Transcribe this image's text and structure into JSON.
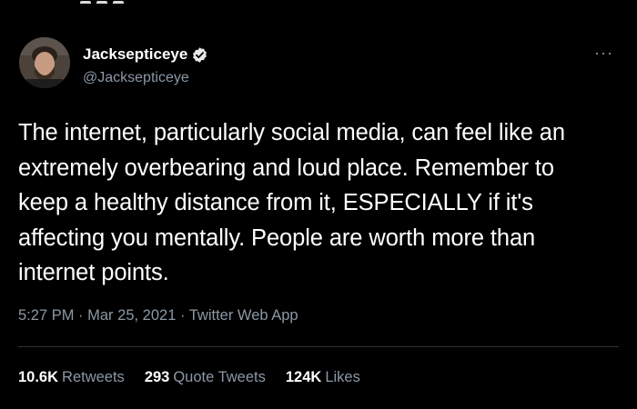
{
  "tweet": {
    "author": {
      "display_name": "Jacksepticeye",
      "handle": "@Jacksepticeye",
      "verified": true,
      "avatar_icon": "avatar"
    },
    "text": "The internet, particularly social media, can feel like an\nextremely overbearing and loud place. Remember to\nkeep a healthy distance from it, ESPECIALLY if it's\naffecting you mentally. People are worth more than\ninternet points.",
    "time": "5:27 PM",
    "date": "Mar 25, 2021",
    "source": "Twitter Web App",
    "stats": [
      {
        "value": "10.6K",
        "label": "Retweets"
      },
      {
        "value": "293",
        "label": "Quote Tweets"
      },
      {
        "value": "124K",
        "label": "Likes"
      }
    ],
    "more_icon": "more-icon"
  },
  "colors": {
    "background": "#000000",
    "primary_text": "#ffffff",
    "secondary_text": "#8b98a5",
    "divider": "#2f3336"
  }
}
